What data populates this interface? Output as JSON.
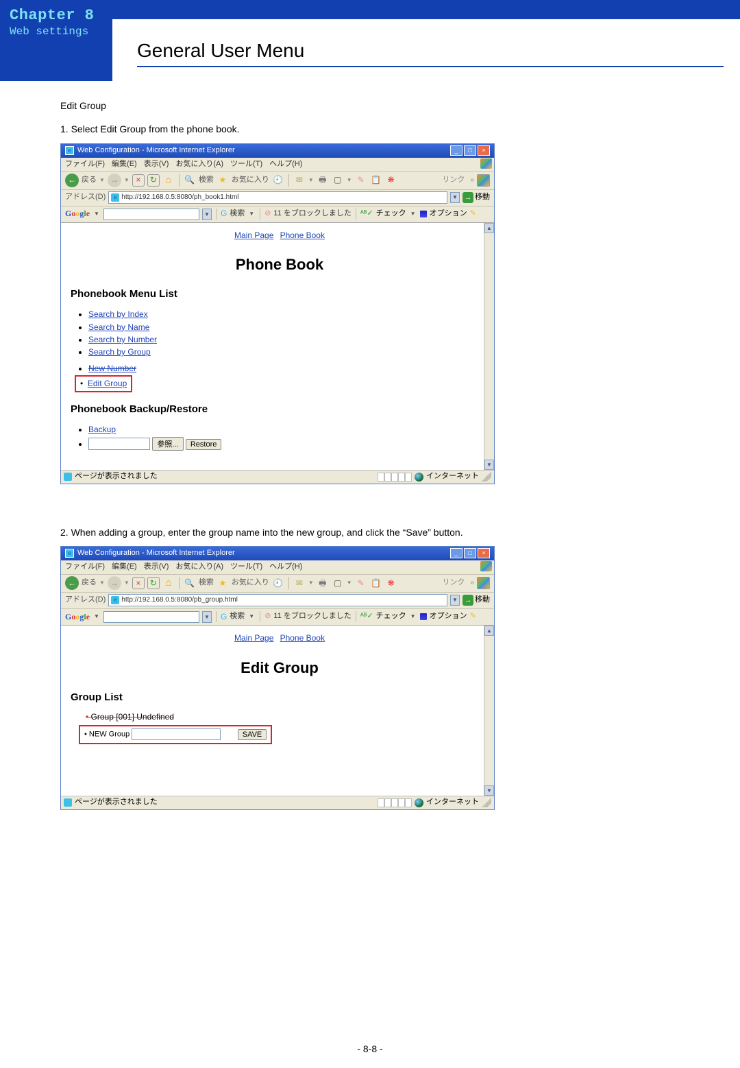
{
  "chapter": {
    "title": "Chapter 8",
    "subtitle": "Web settings"
  },
  "page_title": "General User Menu",
  "section_heading": "Edit Group",
  "step1": "1. Select  Edit Group from the phone book.",
  "step2": "2. When adding a group, enter the group name into the new group, and click the “Save” button.",
  "footer": "- 8-8 -",
  "ie": {
    "titlebar": "Web Configuration - Microsoft Internet Explorer",
    "min": "_",
    "max": "□",
    "close": "×",
    "menu": {
      "file": "ファイル(F)",
      "edit": "編集(E)",
      "view": "表示(V)",
      "fav": "お気に入り(A)",
      "tools": "ツール(T)",
      "help": "ヘルプ(H)"
    },
    "tb": {
      "back": "戻る",
      "back_arrow": "←",
      "fwd_arrow": "→",
      "stop": "×",
      "refresh": "↻",
      "home": "⌂",
      "search": "検索",
      "search_icon": "🔍",
      "fav_icon": "★",
      "favorites": "お気に入り",
      "history_icon": "🕘",
      "links": "リンク",
      "dd": "»"
    },
    "addr": {
      "label": "アドレス(D)",
      "url1": "http://192.168.0.5:8080/ph_book1.html",
      "url2": "http://192.168.0.5:8080/pb_group.html",
      "go": "移動",
      "go_arrow": "→",
      "dd": "▼"
    },
    "google": {
      "logo": "Google",
      "search": "検索",
      "dot": "・",
      "block": "11 をブロックしました",
      "check": "チェック",
      "option": "オプション"
    },
    "status": {
      "done": "ページが表示されました",
      "zone": "インターネット"
    }
  },
  "page1": {
    "top_main": "Main Page",
    "top_phone": "Phone Book",
    "h1": "Phone Book",
    "h2a": "Phonebook Menu List",
    "links": {
      "by_index": "Search by Index",
      "by_name": "Search by Name",
      "by_number": "Search by Number",
      "by_group": "Search by Group",
      "new_number": "New Number",
      "edit_group": "Edit Group"
    },
    "h2b": "Phonebook Backup/Restore",
    "backup": "Backup",
    "browse": "参照...",
    "restore": "Restore"
  },
  "page2": {
    "top_main": "Main Page",
    "top_phone": "Phone Book",
    "h1": "Edit Group",
    "h2": "Group List",
    "crossed": "Group [001] Undefined",
    "new_group": "NEW Group",
    "save": "SAVE"
  }
}
